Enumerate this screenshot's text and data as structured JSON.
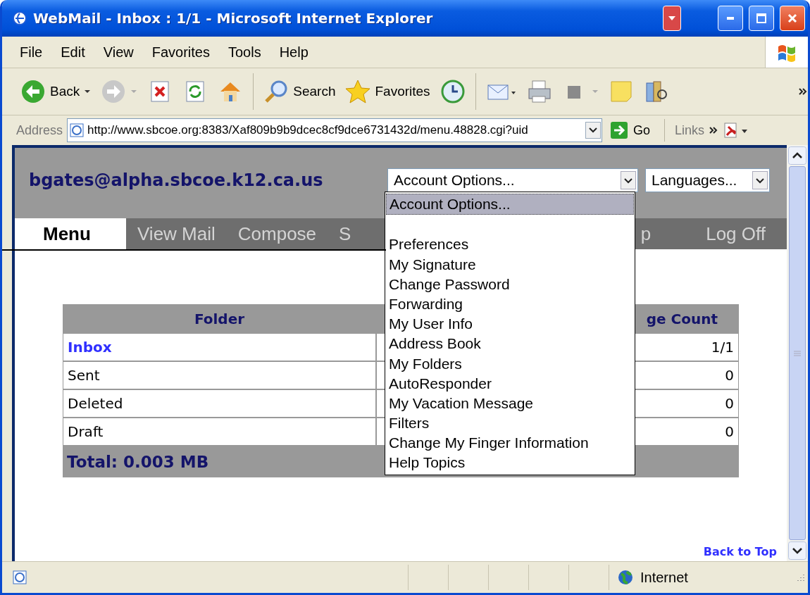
{
  "window": {
    "title": "WebMail - Inbox : 1/1 - Microsoft Internet Explorer"
  },
  "menu_bar": [
    "File",
    "Edit",
    "View",
    "Favorites",
    "Tools",
    "Help"
  ],
  "toolbar": [
    {
      "kind": "back",
      "label": "Back"
    },
    {
      "kind": "forward"
    },
    {
      "kind": "stop"
    },
    {
      "kind": "refresh"
    },
    {
      "kind": "home"
    },
    {
      "kind": "search",
      "label": "Search"
    },
    {
      "kind": "favorites",
      "label": "Favorites"
    },
    {
      "kind": "history"
    },
    {
      "kind": "mail"
    },
    {
      "kind": "print"
    },
    {
      "kind": "edit"
    },
    {
      "kind": "note"
    },
    {
      "kind": "research"
    }
  ],
  "address_bar": {
    "label": "Address",
    "url": "http://www.sbcoe.org:8383/Xaf809b9b9dcec8cf9dce6731432d/menu.48828.cgi?uid",
    "go": "Go",
    "links": "Links"
  },
  "page": {
    "user": "bgates@alpha.sbcoe.k12.ca.us",
    "account_select": "Account Options...",
    "language_select": "Languages...",
    "nav": [
      {
        "label": "Menu",
        "selected": true
      },
      {
        "label": "View Mail",
        "selected": false
      },
      {
        "label": "Compose",
        "selected": false
      },
      {
        "label": "S",
        "selected": false
      },
      {
        "label": "p",
        "selected": false
      },
      {
        "label": "Log Off",
        "selected": false
      }
    ],
    "dropdown": [
      {
        "kind": "option",
        "label": "Account Options...",
        "selected": true
      },
      {
        "kind": "blank",
        "selected": false
      },
      {
        "kind": "option",
        "label": "Preferences",
        "selected": false
      },
      {
        "kind": "option",
        "label": "My Signature",
        "selected": false
      },
      {
        "kind": "option",
        "label": "Change Password",
        "selected": false
      },
      {
        "kind": "option",
        "label": "Forwarding",
        "selected": false
      },
      {
        "kind": "option",
        "label": "My User Info",
        "selected": false
      },
      {
        "kind": "option",
        "label": "Address Book",
        "selected": false
      },
      {
        "kind": "option",
        "label": "My Folders",
        "selected": false
      },
      {
        "kind": "option",
        "label": "AutoResponder",
        "selected": false
      },
      {
        "kind": "option",
        "label": "My Vacation Message",
        "selected": false
      },
      {
        "kind": "option",
        "label": "Filters",
        "selected": false
      },
      {
        "kind": "option",
        "label": "Change My Finger Information",
        "selected": false
      },
      {
        "kind": "option",
        "label": "Help Topics",
        "selected": false
      }
    ],
    "table": {
      "columns": [
        "Folder",
        "ge Count"
      ],
      "rows": [
        {
          "folder": "Inbox",
          "link": true,
          "count": "1/1"
        },
        {
          "folder": "Sent",
          "link": false,
          "count": "0"
        },
        {
          "folder": "Deleted",
          "link": false,
          "count": "0"
        },
        {
          "folder": "Draft",
          "link": false,
          "count": "0"
        }
      ],
      "total": "Total: 0.003 MB"
    },
    "back_to_top": "Back to Top"
  },
  "status_bar": {
    "zone": "Internet"
  }
}
